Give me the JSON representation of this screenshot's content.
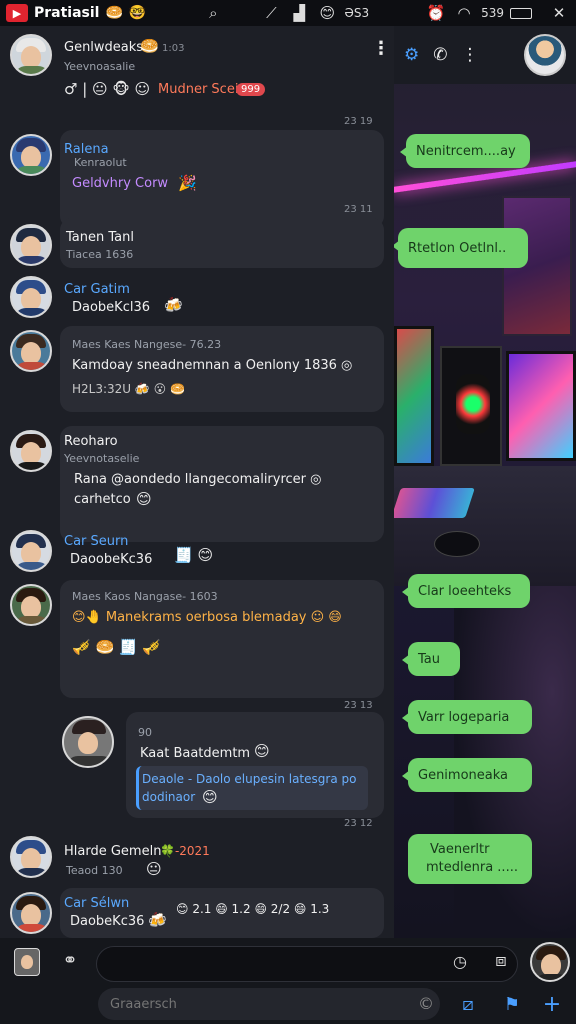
{
  "status_bar": {
    "app_badge": "▶",
    "title": "Pratiasil",
    "emoji1": "🥯",
    "emoji2": "🤓",
    "time_text": "ƏS3",
    "battery_text": "539",
    "close": "✕"
  },
  "header": {
    "contact_name": "Genlwdeaks",
    "contact_emoji": "🥯",
    "contact_time": "1:03",
    "contact_status": "Yeevnoasalie",
    "status_row": "Mudner Scein",
    "status_badge": "999"
  },
  "messages": [
    {
      "time": "23  19"
    },
    {
      "name": "Ralena",
      "sub": "Kenraolut",
      "text": "Geldvhry Corw",
      "emoji": "🎉",
      "time": "23  11"
    },
    {
      "name": "Tanen Tanl",
      "sub": "Tiacea 1636"
    },
    {
      "name": "Car Gatim",
      "text": "DaobeKcl36",
      "emoji": "🍻"
    },
    {
      "name": "Maes Kaes Nangese- 76.23",
      "text": "Kamdoay sneadnemnan a Oenlony 1836 ◎",
      "emoji_row": "H2L3:32U 🍻 😮 🥯"
    },
    {
      "name": "Reoharo",
      "sub": "Yeevnotaselie",
      "text1": "Rana @aondedo llangecomaliryrcer ◎",
      "text2": "carhetco",
      "emoji": "😊"
    },
    {
      "name": "Car Seurn",
      "text": "DaoobeKc36",
      "emoji": "🧾 😊"
    },
    {
      "name": "Maes Kaos Nangase- 1603",
      "text": "😊🤚 Manekrams oerbosa blemaday ☺ 😄",
      "emoji_row": "🎺 🥯 🧾 🎺",
      "time": "23  13"
    },
    {
      "header": "90",
      "text": "Kaat Baatdemtm",
      "emoji": "😊",
      "quote1": "Deaole - Daolo elupesin latesgra po",
      "quote2": "dodinaor",
      "quote_emoji": "😊",
      "time": "23  12"
    },
    {
      "name": "Hlarde Gemeln",
      "name_suffix": "🍀-2021",
      "sub": "Teaod 130",
      "emoji": "😐"
    },
    {
      "name": "Car Sélwn",
      "text": "DaobeKc36",
      "emoji": "🍻",
      "reactions": "😊 2.1  😄 1.2  😄 2/2  😄 1.3"
    }
  ],
  "right_pane": {
    "bubbles": [
      "Nenitrcem....ay",
      "Rtetlon Oetlnl..",
      "Clar loeehteks",
      "Tau",
      "Varr logeparia",
      "Genimoneaka",
      "Vaenerltr",
      "mtedlenra ....."
    ]
  },
  "input": {
    "placeholder": "Graaersch"
  },
  "colors": {
    "accent_blue": "#4a9fff",
    "bubble_green": "#6fd36b",
    "bg_dark": "#1d1f26",
    "badge_red": "#e0484d"
  }
}
